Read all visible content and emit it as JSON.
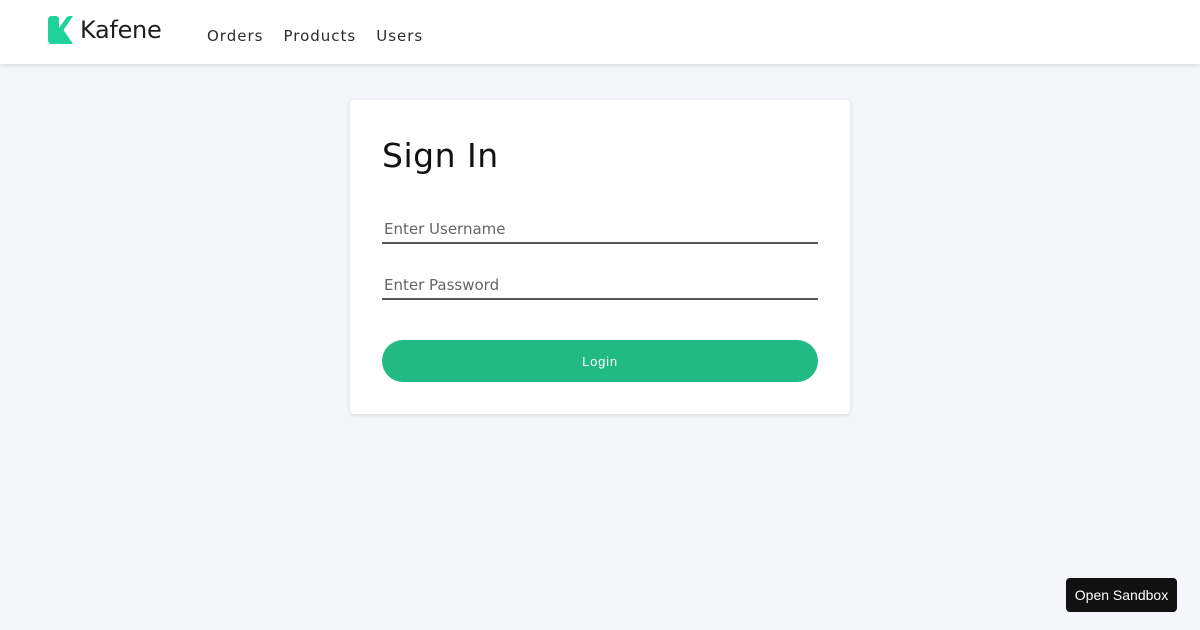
{
  "header": {
    "brand_name": "Kafene",
    "brand_icon": "kafene-k-logo",
    "brand_color": "#1fd29a",
    "nav": [
      {
        "label": "Orders"
      },
      {
        "label": "Products"
      },
      {
        "label": "Users"
      }
    ]
  },
  "signin": {
    "title": "Sign In",
    "username_placeholder": "Enter Username",
    "username_value": "",
    "password_placeholder": "Enter Password",
    "password_value": "",
    "login_label": "Login",
    "button_color": "#21b984"
  },
  "sandbox": {
    "label": "Open Sandbox"
  }
}
